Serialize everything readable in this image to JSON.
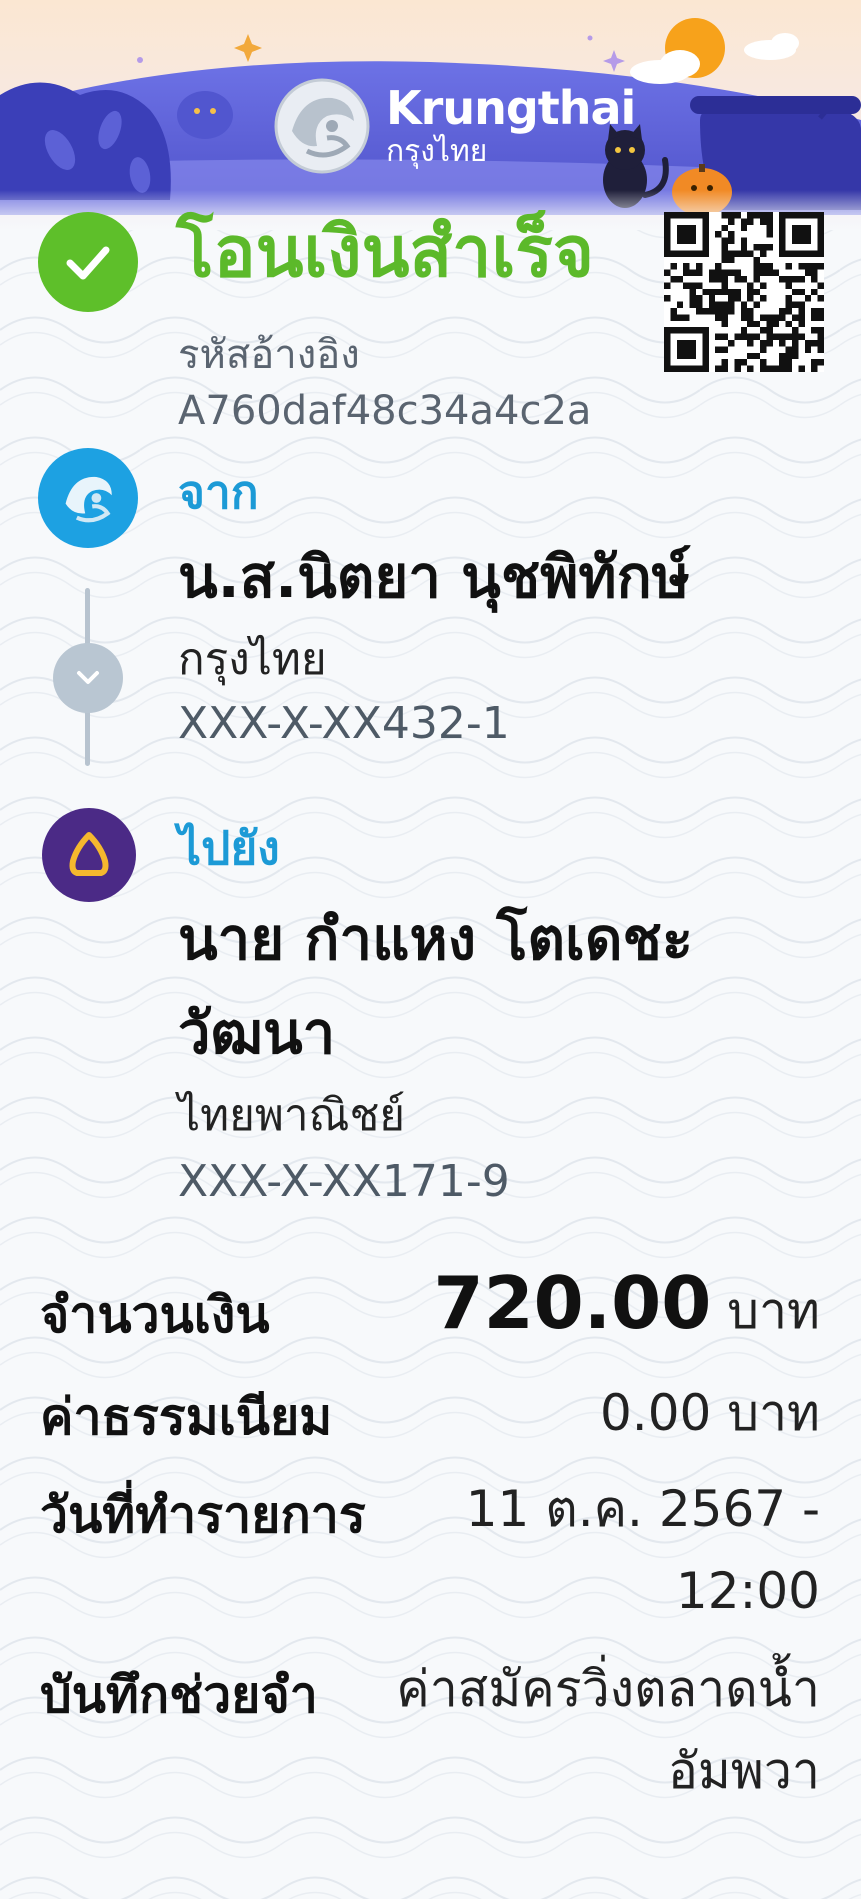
{
  "header": {
    "brand_en": "Krungthai",
    "brand_th": "กรุงไทย"
  },
  "status": {
    "title": "โอนเงินสำเร็จ",
    "ref_label": "รหัสอ้างอิง",
    "ref_value": "A760daf48c34a4c2a"
  },
  "sender": {
    "label": "จาก",
    "name": "น.ส.นิตยา นุชพิทักษ์",
    "bank": "กรุงไทย",
    "account": "XXX-X-XX432-1"
  },
  "receiver": {
    "label": "ไปยัง",
    "name": "นาย กำแหง โตเดชะวัฒนา",
    "bank": "ไทยพาณิชย์",
    "account": "XXX-X-XX171-9"
  },
  "details": {
    "amount_label": "จำนวนเงิน",
    "amount_value": "720.00",
    "amount_unit": "บาท",
    "fee_label": "ค่าธรรมเนียม",
    "fee_value": "0.00 บาท",
    "date_label": "วันที่ทำรายการ",
    "date_value": "11 ต.ค. 2567 - 12:00",
    "memo_label": "บันทึกช่วยจำ",
    "memo_value": "ค่าสมัครวิ่งตลาดน้ำอัมพวา"
  },
  "colors": {
    "success": "#5cb92a",
    "accent_blue": "#1c9ad6",
    "header_purple": "#5a5fd8",
    "scb_purple": "#4b2a86"
  }
}
